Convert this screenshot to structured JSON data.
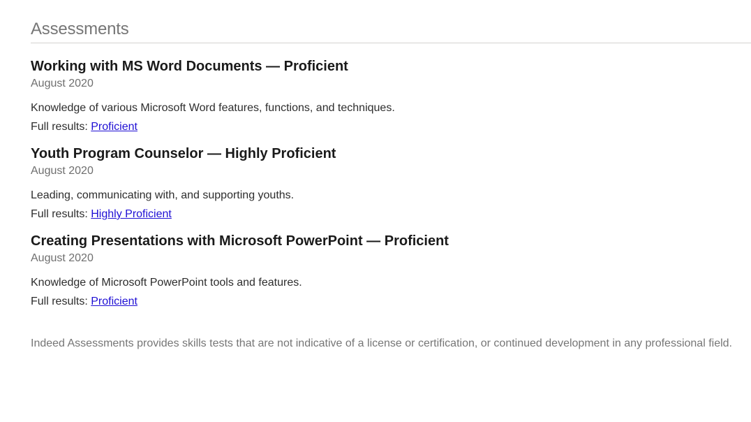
{
  "section": {
    "title": "Assessments",
    "items": [
      {
        "title": "Working with MS Word Documents — Proficient",
        "date": "August 2020",
        "description": "Knowledge of various Microsoft Word features, functions, and techniques.",
        "results_label": "Full results:",
        "results_link": "Proficient"
      },
      {
        "title": "Youth Program Counselor — Highly Proficient",
        "date": "August 2020",
        "description": "Leading, communicating with, and supporting youths.",
        "results_label": "Full results:",
        "results_link": "Highly Proficient"
      },
      {
        "title": "Creating Presentations with Microsoft PowerPoint — Proficient",
        "date": "August 2020",
        "description": "Knowledge of Microsoft PowerPoint tools and features.",
        "results_label": "Full results:",
        "results_link": "Proficient"
      }
    ],
    "disclaimer": "Indeed Assessments provides skills tests that are not indicative of a license or certification, or continued development in any professional field."
  },
  "colors": {
    "link": "#1f0fd4",
    "heading_muted": "#767676",
    "divider": "#d4d2d0"
  }
}
